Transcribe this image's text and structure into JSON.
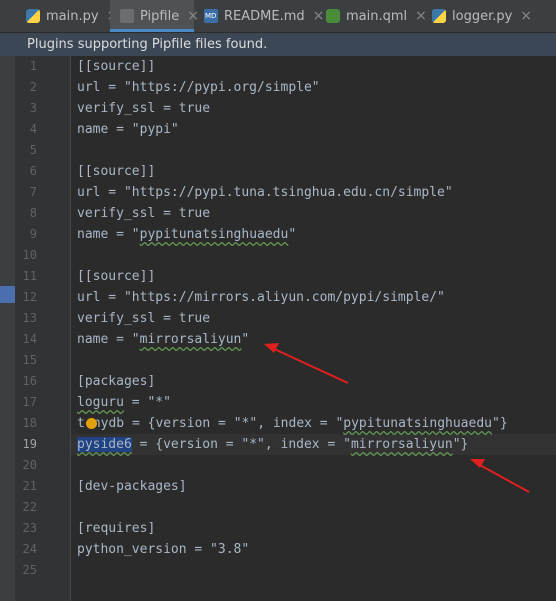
{
  "tabs": [
    {
      "label": "main.py",
      "icon": "python-file-icon",
      "active": false
    },
    {
      "label": "Pipfile",
      "icon": "pipfile-icon",
      "active": true
    },
    {
      "label": "README.md",
      "icon": "markdown-file-icon",
      "active": false
    },
    {
      "label": "main.qml",
      "icon": "qml-file-icon",
      "active": false
    },
    {
      "label": "logger.py",
      "icon": "python-file-icon",
      "active": false
    }
  ],
  "tab_close_glyph": "×",
  "notification": "Plugins supporting Pipfile files found.",
  "line_numbers": [
    "1",
    "2",
    "3",
    "4",
    "5",
    "6",
    "7",
    "8",
    "9",
    "10",
    "11",
    "12",
    "13",
    "14",
    "15",
    "16",
    "17",
    "18",
    "19",
    "20",
    "21",
    "22",
    "23",
    "24",
    "25"
  ],
  "current_line": "19",
  "code": {
    "l1": "[[source]]",
    "l2": "url = \"https://pypi.org/simple\"",
    "l3": "verify_ssl = true",
    "l4": "name = \"pypi\"",
    "l6": "[[source]]",
    "l7": "url = \"https://pypi.tuna.tsinghua.edu.cn/simple\"",
    "l8": "verify_ssl = true",
    "l9_a": "name = \"",
    "l9_b": "pypitunatsinghuaedu",
    "l9_c": "\"",
    "l11": "[[source]]",
    "l12": "url = \"https://mirrors.aliyun.com/pypi/simple/\"",
    "l13": "verify_ssl = true",
    "l14_a": "name = \"",
    "l14_b": "mirrorsaliyun",
    "l14_c": "\"",
    "l16": "[packages]",
    "l17_a": "loguru",
    "l17_b": " = \"*\"",
    "l18_a": "t",
    "l18_b": "nydb = {version = \"*\", index = \"",
    "l18_c": "pypitunatsinghuaedu",
    "l18_d": "\"}",
    "l19_a": "pyside6",
    "l19_b": " = {version = \"*\", index = \"",
    "l19_c": "mirrorsaliyun",
    "l19_d": "\"}",
    "l21": "[dev-packages]",
    "l23": "[requires]",
    "l24": "python_version = \"3.8\""
  },
  "colors": {
    "annotation_arrow": "#e02020",
    "accent": "#4a88c7",
    "editor_bg": "#2b2b2b"
  }
}
